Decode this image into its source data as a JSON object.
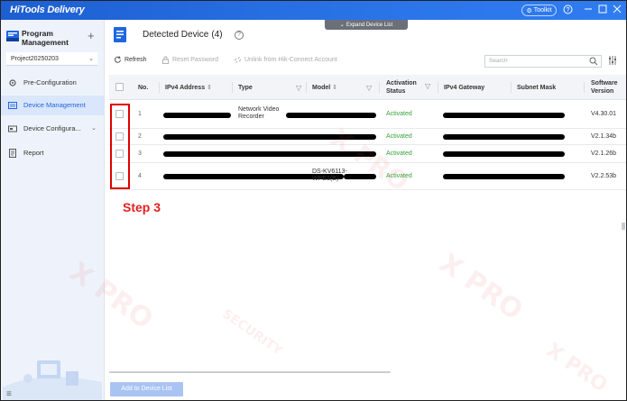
{
  "app": {
    "title": "HiTools Delivery",
    "toolkit_label": "Toolkit",
    "expand_label": "Expand Device List"
  },
  "sidebar": {
    "header_title": "Program Management",
    "project": "Project20250203",
    "items": [
      {
        "label": "Pre-Configuration",
        "icon": "gear-icon"
      },
      {
        "label": "Device Management",
        "icon": "device-list-icon",
        "active": true
      },
      {
        "label": "Device Configura...",
        "icon": "device-config-icon"
      },
      {
        "label": "Report",
        "icon": "report-icon"
      }
    ]
  },
  "main": {
    "title": "Detected Device",
    "count": "(4)",
    "toolbar": {
      "refresh": "Refresh",
      "reset_password": "Reset Password",
      "unlink": "Unlink from Hik-Connect Account"
    },
    "search_placeholder": "Search",
    "columns": {
      "no": "No.",
      "ipv4": "IPv4 Address",
      "type": "Type",
      "model": "Model",
      "activation_line1": "Activation",
      "activation_line2": "Status",
      "gateway": "IPv4 Gateway",
      "subnet": "Subnet Mask",
      "software_line1": "Software",
      "software_line2": "Version"
    },
    "rows": [
      {
        "no": "1",
        "type": "Network Video Recorder",
        "model": "",
        "status": "Activated",
        "version": "V4.30.01"
      },
      {
        "no": "2",
        "type": "",
        "model": "",
        "status": "Activated",
        "version": "V2.1.34b"
      },
      {
        "no": "3",
        "type": "",
        "model": "",
        "status": "Activated",
        "version": "V2.1.26b"
      },
      {
        "no": "4",
        "type": "",
        "model": "DS-KV6113-WPE1(B)",
        "status": "Activated",
        "version": "V2.2.53b"
      }
    ],
    "add_button": "Add to Device List"
  },
  "annotation": {
    "step_label": "Step 3"
  },
  "watermark": {
    "text": "X PRO",
    "subtext": "SECURITY"
  },
  "colors": {
    "titlebar": "#2a74e8",
    "accent": "#1f66e0",
    "activated": "#35a33a",
    "annotation": "#e00000"
  }
}
